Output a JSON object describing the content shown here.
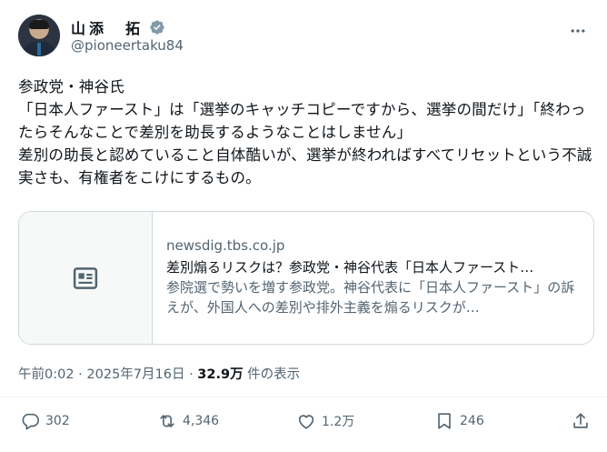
{
  "author": {
    "display_name": "山添　拓",
    "handle": "@pioneertaku84",
    "verified_color": "#829aab"
  },
  "tweet": {
    "text": "参政党・神谷氏\n「日本人ファースト」は「選挙のキャッチコピーですから、選挙の間だけ」「終わったらそんなことで差別を助長するようなことはしません」\n差別の助長と認めていること自体酷いが、選挙が終わればすべてリセットという不誠実さも、有権者をこけにするもの。"
  },
  "card": {
    "thumbnail_icon": "article-icon",
    "domain": "newsdig.tbs.co.jp",
    "title": "差別煽るリスクは？参政党・神谷代表「日本人ファースト…",
    "description": "参院選で勢いを増す参政党。神谷代表に「日本人ファースト」の訴えが、外国人への差別や排外主義を煽るリスクが…"
  },
  "meta": {
    "timestamp": "午前0:02 · 2025年7月16日 · ",
    "views_count": "32.9万",
    "views_label": " 件の表示"
  },
  "actions": {
    "replies": "302",
    "reposts": "4,346",
    "likes": "1.2万",
    "bookmarks": "246"
  }
}
